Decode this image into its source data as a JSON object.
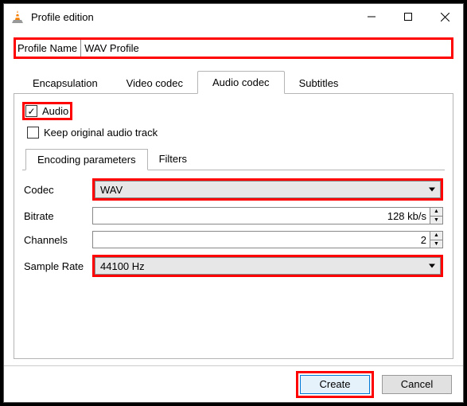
{
  "window": {
    "title": "Profile edition"
  },
  "profile": {
    "label": "Profile Name",
    "value": "WAV Profile"
  },
  "tabs": {
    "encapsulation": "Encapsulation",
    "video": "Video codec",
    "audio": "Audio codec",
    "subtitles": "Subtitles"
  },
  "audio": {
    "checkbox": "Audio",
    "keep": "Keep original audio track",
    "inner_tabs": {
      "encoding": "Encoding parameters",
      "filters": "Filters"
    },
    "codec": {
      "label": "Codec",
      "value": "WAV"
    },
    "bitrate": {
      "label": "Bitrate",
      "value": "128 kb/s"
    },
    "channels": {
      "label": "Channels",
      "value": "2"
    },
    "sample_rate": {
      "label": "Sample Rate",
      "value": "44100 Hz"
    }
  },
  "buttons": {
    "create": "Create",
    "cancel": "Cancel"
  }
}
